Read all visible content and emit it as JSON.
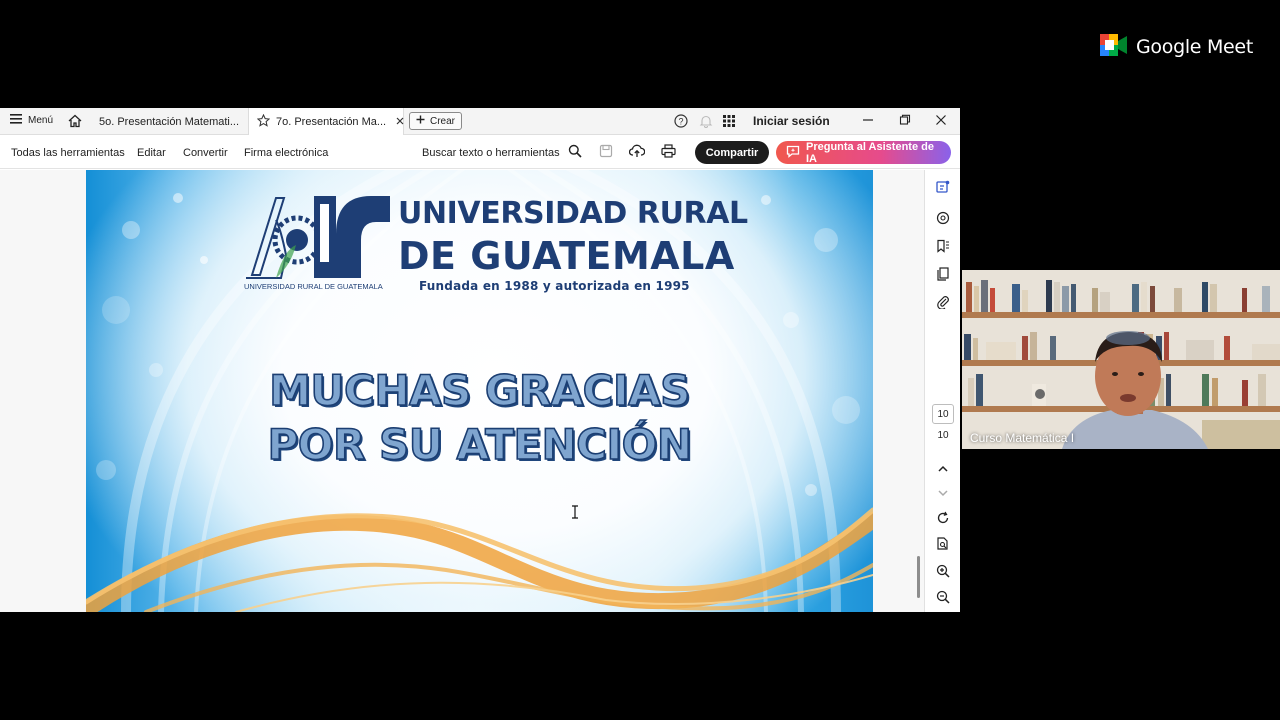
{
  "meet": {
    "brand": "Google Meet"
  },
  "app": {
    "tabbar": {
      "menu_label": "Menú",
      "tabs": [
        {
          "label": "5o. Presentación Matemati..."
        },
        {
          "label": "7o. Presentación Ma..."
        }
      ],
      "create_label": "Crear",
      "sign_in_label": "Iniciar sesión"
    },
    "toolbar": {
      "all_tools": "Todas las herramientas",
      "edit": "Editar",
      "convert": "Convertir",
      "esign": "Firma electrónica",
      "search": "Buscar texto o herramientas",
      "share": "Compartir",
      "ai_assistant": "Pregunta al Asistente de IA"
    },
    "page_nav": {
      "current": "10",
      "total": "10"
    }
  },
  "slide": {
    "university_line1": "UNIVERSIDAD RURAL",
    "university_line2": "DE GUATEMALA",
    "university_tagline": "Fundada en 1988 y autorizada en 1995",
    "logo_caption": "UNIVERSIDAD RURAL DE GUATEMALA",
    "thanks_line1": "MUCHAS GRACIAS",
    "thanks_line2": "POR SU ATENCIÓN"
  },
  "participant": {
    "name": "Curso Matemática I"
  },
  "colors": {
    "brand_navy": "#1e3e75",
    "accent_orange": "#f0a23c",
    "ai_gradient_start": "#f0584e",
    "ai_gradient_end": "#8a62ea"
  }
}
